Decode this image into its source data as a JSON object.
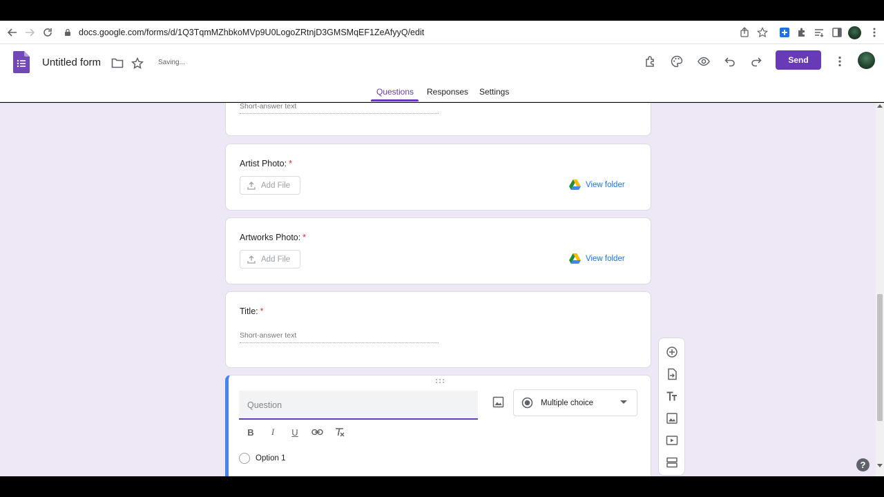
{
  "browser": {
    "url": "docs.google.com/forms/d/1Q3TqmMZhbkoMVp9U0LogoZRtnjD3GMSMqEF1ZeAfyyQ/edit"
  },
  "header": {
    "form_title": "Untitled form",
    "saving_status": "Saving...",
    "send_label": "Send",
    "accent_color": "#673ab7"
  },
  "tabs": [
    {
      "label": "Questions",
      "active": true
    },
    {
      "label": "Responses",
      "active": false
    },
    {
      "label": "Settings",
      "active": false
    }
  ],
  "cards": {
    "partial": {
      "placeholder": "Short-answer text"
    },
    "artist_photo": {
      "label": "Artist Photo:",
      "required_mark": "*",
      "add_file": "Add File",
      "view_folder": "View folder"
    },
    "artworks_photo": {
      "label": "Artworks Photo:",
      "required_mark": "*",
      "add_file": "Add File",
      "view_folder": "View folder"
    },
    "title": {
      "label": "Title:",
      "required_mark": "*",
      "placeholder": "Short-answer text"
    },
    "active": {
      "question_placeholder": "Question",
      "type": "Multiple choice",
      "format": {
        "bold": "B",
        "italic": "I",
        "underline": "U"
      },
      "option_1": "Option 1"
    }
  },
  "toolbar_icons": [
    "add-question-icon",
    "import-questions-icon",
    "add-title-icon",
    "add-image-icon",
    "add-video-icon",
    "add-section-icon"
  ]
}
